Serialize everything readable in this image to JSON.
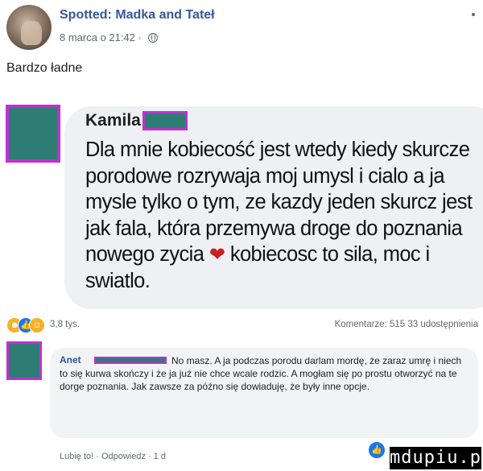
{
  "post": {
    "page_name": "Spotted: Madka and Tateł",
    "timestamp": "8 marca o 21:42 ·",
    "caption": "Bardzo ładne"
  },
  "shared_image": {
    "name": "Kamila",
    "text": "Dla mnie kobiecość jest wtedy kiedy skurcze porodowe rozrywaja moj umysl i cialo a ja mysle tylko o tym, ze kazdy jeden skurcz jest jak fala, która przemywa droge do poznania nowego zycia",
    "text_end": "kobiecosc to sila, moc i swiatlo."
  },
  "reactions": {
    "count": "3,8 tys.",
    "comments_shares": "Komentarze: 515   33 udostępnienia"
  },
  "comment": {
    "author": "Anet",
    "text": "No masz. A ja podczas porodu darlam mordę, że zaraz umrę i niech to się kurwa skończy i że ja już nie chce wcale rodzic. A mogłam się po prostu otworzyć na te dorge poznania. Jak zawsze za późno się dowiaduję, że były inne opcje.",
    "like": "Lubię to!",
    "reply": "Odpowiedz",
    "age": "1 d"
  },
  "watermark": "mdupiu.pl",
  "colors": {
    "link": "#365899",
    "accent": "#c030d0",
    "censor": "#2e7d74",
    "heart": "#c9201f"
  }
}
